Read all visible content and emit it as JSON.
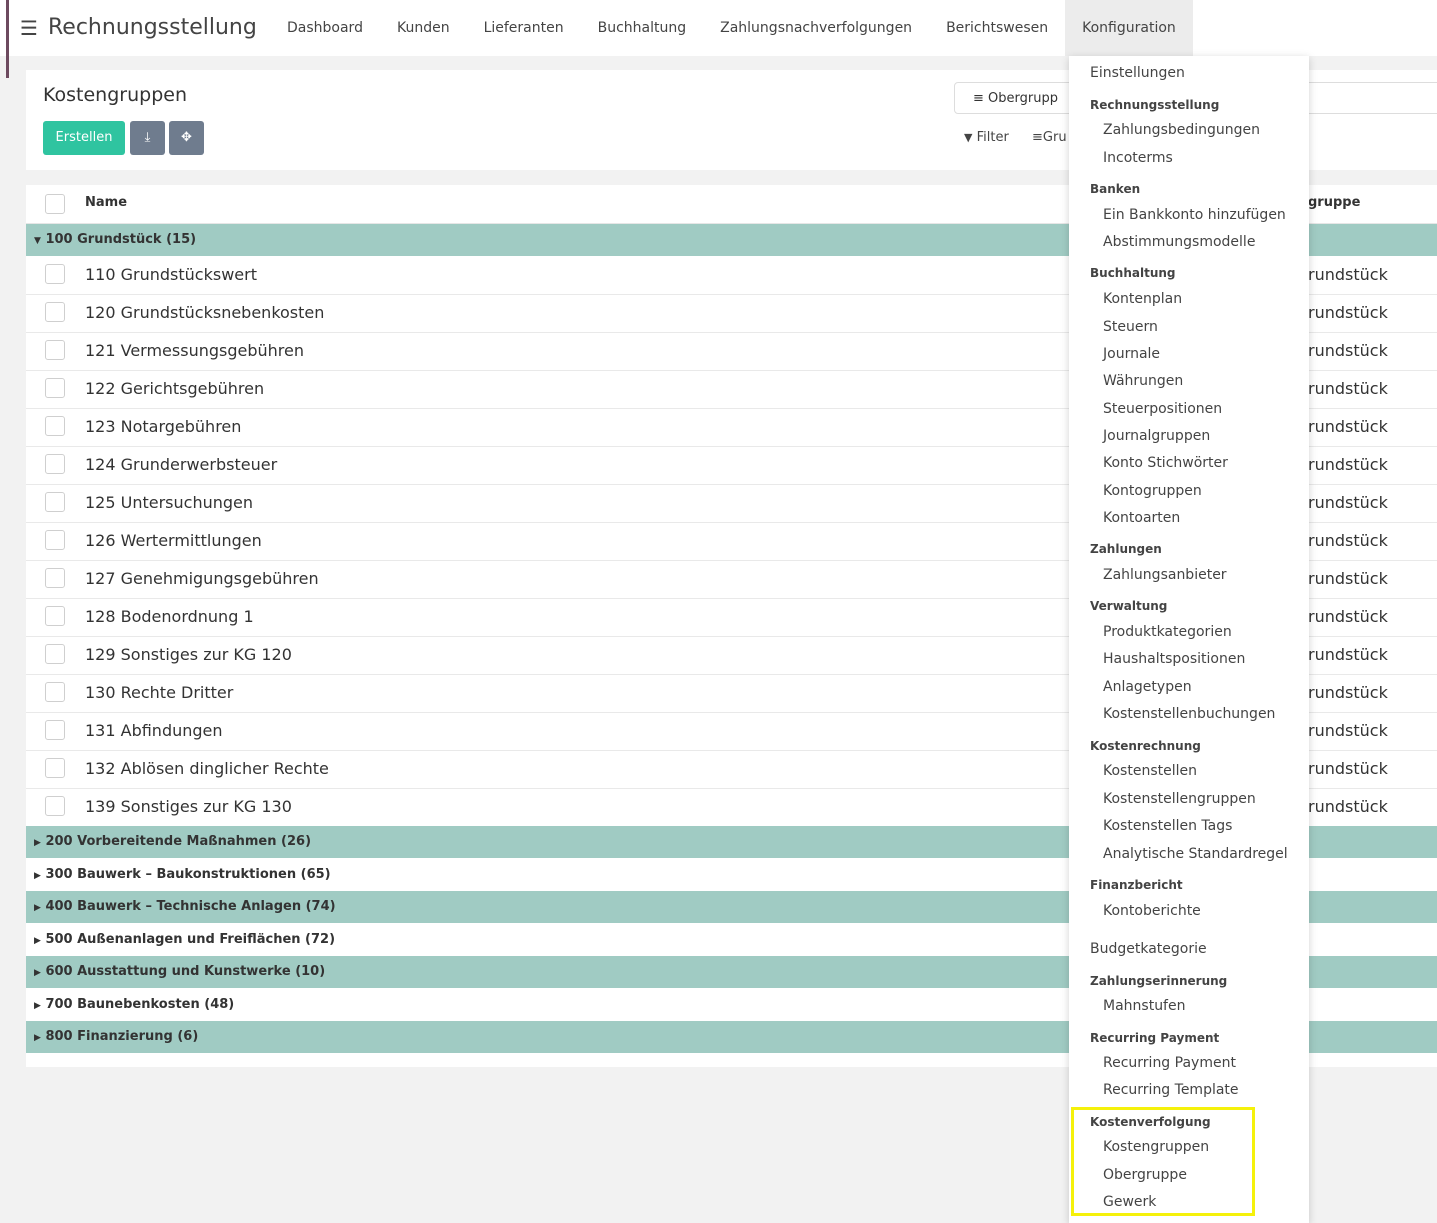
{
  "navbar": {
    "brand": "Rechnungsstellung",
    "items": [
      "Dashboard",
      "Kunden",
      "Lieferanten",
      "Buchhaltung",
      "Zahlungsnachverfolgungen",
      "Berichtswesen",
      "Konfiguration"
    ]
  },
  "control_panel": {
    "title": "Kostengruppen",
    "create_label": "Erstellen",
    "groupby_chip": "Obergrupp",
    "filter_label": "Filter",
    "group_label": "Gru"
  },
  "list": {
    "col_name": "Name",
    "col_parent": "gruppe",
    "groups": [
      {
        "label": "100 Grundstück (15)",
        "expanded": true
      },
      {
        "label": "200 Vorbereitende Maßnahmen (26)",
        "expanded": false
      },
      {
        "label": "300 Bauwerk – Baukonstruktionen (65)",
        "expanded": false
      },
      {
        "label": "400 Bauwerk – Technische Anlagen (74)",
        "expanded": false
      },
      {
        "label": "500 Außenanlagen und Freiflächen (72)",
        "expanded": false
      },
      {
        "label": "600 Ausstattung und Kunstwerke (10)",
        "expanded": false
      },
      {
        "label": "700 Baunebenkosten (48)",
        "expanded": false
      },
      {
        "label": "800 Finanzierung (6)",
        "expanded": false
      }
    ],
    "rows": [
      {
        "name": "110 Grundstückswert",
        "parent": "rundstück"
      },
      {
        "name": "120 Grundstücksnebenkosten",
        "parent": "rundstück"
      },
      {
        "name": "121 Vermessungsgebühren",
        "parent": "rundstück"
      },
      {
        "name": "122 Gerichtsgebühren",
        "parent": "rundstück"
      },
      {
        "name": "123 Notargebühren",
        "parent": "rundstück"
      },
      {
        "name": "124 Grunderwerbsteuer",
        "parent": "rundstück"
      },
      {
        "name": "125 Untersuchungen",
        "parent": "rundstück"
      },
      {
        "name": "126 Wertermittlungen",
        "parent": "rundstück"
      },
      {
        "name": "127 Genehmigungsgebühren",
        "parent": "rundstück"
      },
      {
        "name": "128 Bodenordnung 1",
        "parent": "rundstück"
      },
      {
        "name": "129 Sonstiges zur KG 120",
        "parent": "rundstück"
      },
      {
        "name": "130 Rechte Dritter",
        "parent": "rundstück"
      },
      {
        "name": "131 Abfindungen",
        "parent": "rundstück"
      },
      {
        "name": "132 Ablösen dinglicher Rechte",
        "parent": "rundstück"
      },
      {
        "name": "139 Sonstiges zur KG 130",
        "parent": "rundstück"
      }
    ]
  },
  "dropdown": {
    "entries": [
      {
        "kind": "top",
        "label": "Einstellungen"
      },
      {
        "kind": "header",
        "label": "Rechnungsstellung"
      },
      {
        "kind": "item",
        "label": "Zahlungsbedingungen"
      },
      {
        "kind": "item",
        "label": "Incoterms"
      },
      {
        "kind": "header",
        "label": "Banken"
      },
      {
        "kind": "item",
        "label": "Ein Bankkonto hinzufügen"
      },
      {
        "kind": "item",
        "label": "Abstimmungsmodelle"
      },
      {
        "kind": "header",
        "label": "Buchhaltung"
      },
      {
        "kind": "item",
        "label": "Kontenplan"
      },
      {
        "kind": "item",
        "label": "Steuern"
      },
      {
        "kind": "item",
        "label": "Journale"
      },
      {
        "kind": "item",
        "label": "Währungen"
      },
      {
        "kind": "item",
        "label": "Steuerpositionen"
      },
      {
        "kind": "item",
        "label": "Journalgruppen"
      },
      {
        "kind": "item",
        "label": "Konto Stichwörter"
      },
      {
        "kind": "item",
        "label": "Kontogruppen"
      },
      {
        "kind": "item",
        "label": "Kontoarten"
      },
      {
        "kind": "header",
        "label": "Zahlungen"
      },
      {
        "kind": "item",
        "label": "Zahlungsanbieter"
      },
      {
        "kind": "header",
        "label": "Verwaltung"
      },
      {
        "kind": "item",
        "label": "Produktkategorien"
      },
      {
        "kind": "item",
        "label": "Haushaltspositionen"
      },
      {
        "kind": "item",
        "label": "Anlagetypen"
      },
      {
        "kind": "item",
        "label": "Kostenstellenbuchungen"
      },
      {
        "kind": "header",
        "label": "Kostenrechnung"
      },
      {
        "kind": "item",
        "label": "Kostenstellen"
      },
      {
        "kind": "item",
        "label": "Kostenstellengruppen"
      },
      {
        "kind": "item",
        "label": "Kostenstellen Tags"
      },
      {
        "kind": "item",
        "label": "Analytische Standardregel"
      },
      {
        "kind": "header",
        "label": "Finanzbericht"
      },
      {
        "kind": "item",
        "label": "Kontoberichte"
      },
      {
        "kind": "top",
        "label": "Budgetkategorie"
      },
      {
        "kind": "header",
        "label": "Zahlungserinnerung"
      },
      {
        "kind": "item",
        "label": "Mahnstufen"
      },
      {
        "kind": "header",
        "label": "Recurring Payment"
      },
      {
        "kind": "item",
        "label": "Recurring Payment"
      },
      {
        "kind": "item",
        "label": "Recurring Template"
      },
      {
        "kind": "header",
        "label": "Kostenverfolgung"
      },
      {
        "kind": "item",
        "label": "Kostengruppen"
      },
      {
        "kind": "item",
        "label": "Obergruppe"
      },
      {
        "kind": "item",
        "label": "Gewerk"
      }
    ]
  },
  "colors": {
    "accent_teal": "#2fc4a0",
    "group_row": "#a0cbc3",
    "highlight": "#f5f10a"
  }
}
